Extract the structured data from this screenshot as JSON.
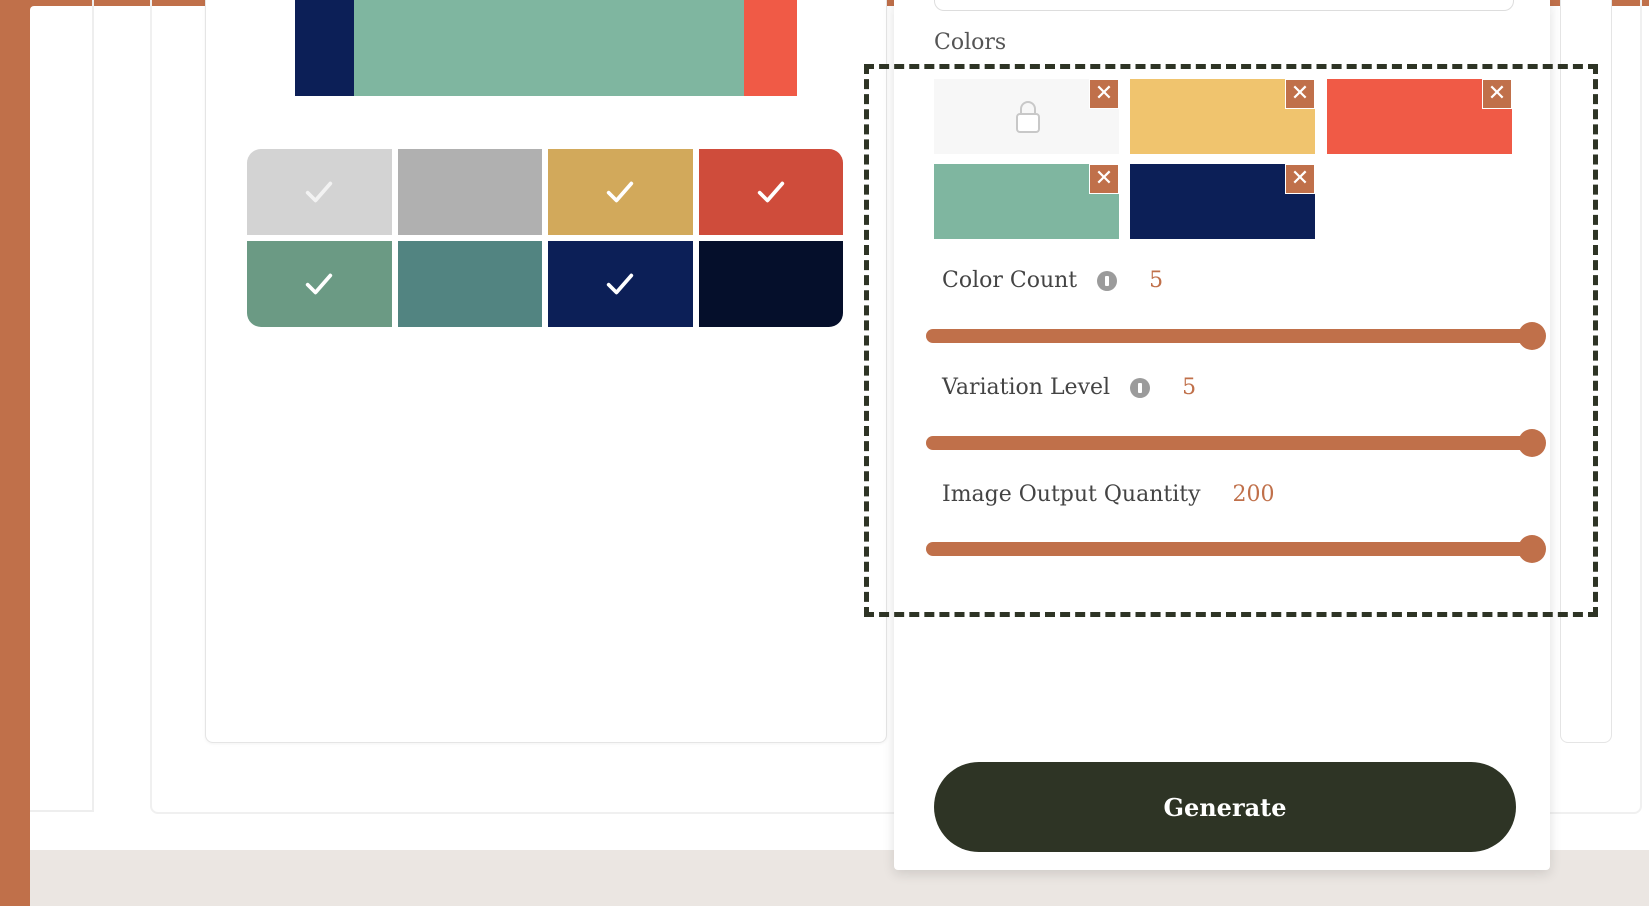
{
  "preview_bar": {
    "colors": [
      "#0c1f57",
      "#7fb6a0",
      "#f05a46"
    ],
    "weights": [
      1,
      6.6,
      0.9
    ]
  },
  "swatch_grid": {
    "swatches": [
      {
        "color": "#d3d3d3",
        "checked": true,
        "check_color": "#f2f2f2"
      },
      {
        "color": "#b0b0b0",
        "checked": false
      },
      {
        "color": "#d2a95b",
        "checked": true,
        "check_color": "#ffffff"
      },
      {
        "color": "#cf4c3b",
        "checked": true,
        "check_color": "#ffffff"
      },
      {
        "color": "#6b9a84",
        "checked": true,
        "check_color": "#ffffff"
      },
      {
        "color": "#528481",
        "checked": false
      },
      {
        "color": "#0c1f57",
        "checked": true,
        "check_color": "#ffffff"
      },
      {
        "color": "#050f2b",
        "checked": false
      }
    ]
  },
  "settings": {
    "colors_label": "Colors",
    "colors": [
      {
        "name": "locked-white",
        "color": "#f7f7f7",
        "icon": "lock-icon"
      },
      {
        "name": "yellow",
        "color": "#f0c46e"
      },
      {
        "name": "coral",
        "color": "#f05a46"
      },
      {
        "name": "sage",
        "color": "#7fb6a0"
      },
      {
        "name": "navy",
        "color": "#0c1f57"
      }
    ],
    "remove_glyph": "✕",
    "sliders": [
      {
        "label": "Color Count",
        "value": "5",
        "info": true,
        "fraction": 1.0
      },
      {
        "label": "Variation Level",
        "value": "5",
        "info": true,
        "fraction": 1.0
      },
      {
        "label": "Image Output Quantity",
        "value": "200",
        "info": false,
        "fraction": 1.0
      }
    ],
    "generate_label": "Generate"
  },
  "accent": "#c0704a",
  "dark": "#2e3425"
}
